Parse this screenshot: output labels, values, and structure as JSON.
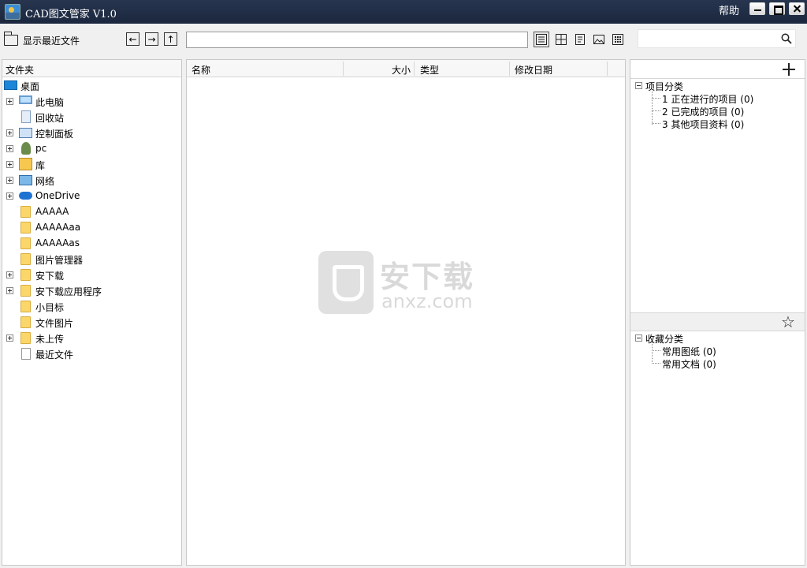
{
  "window": {
    "title": "CAD图文管家 V1.0",
    "help_label": "帮助"
  },
  "toolbar": {
    "recent_files_label": "显示最近文件",
    "path_value": "",
    "search_value": "",
    "view_buttons": [
      "list-view-icon",
      "thumbnail-view-icon",
      "detail-view-icon",
      "image-view-icon",
      "grid-view-icon"
    ]
  },
  "folders": {
    "header": "文件夹",
    "items": [
      {
        "label": "桌面",
        "icon": "desktop-icon",
        "expandable": false
      },
      {
        "label": "此电脑",
        "icon": "computer-icon",
        "expandable": true
      },
      {
        "label": "回收站",
        "icon": "recycle-bin-icon",
        "expandable": false
      },
      {
        "label": "控制面板",
        "icon": "control-panel-icon",
        "expandable": true
      },
      {
        "label": "pc",
        "icon": "user-icon",
        "expandable": true
      },
      {
        "label": "库",
        "icon": "library-icon",
        "expandable": true
      },
      {
        "label": "网络",
        "icon": "network-icon",
        "expandable": true
      },
      {
        "label": "OneDrive",
        "icon": "cloud-icon",
        "expandable": true
      },
      {
        "label": "AAAAA",
        "icon": "folder-icon",
        "expandable": false
      },
      {
        "label": "AAAAAaa",
        "icon": "folder-icon",
        "expandable": false
      },
      {
        "label": "AAAAAas",
        "icon": "folder-icon",
        "expandable": false
      },
      {
        "label": "图片管理器",
        "icon": "folder-icon",
        "expandable": false
      },
      {
        "label": "安下载",
        "icon": "folder-icon",
        "expandable": true
      },
      {
        "label": "安下载应用程序",
        "icon": "folder-icon",
        "expandable": true
      },
      {
        "label": "小目标",
        "icon": "folder-icon",
        "expandable": false
      },
      {
        "label": "文件图片",
        "icon": "folder-icon",
        "expandable": false
      },
      {
        "label": "未上传",
        "icon": "folder-icon",
        "expandable": true
      },
      {
        "label": "最近文件",
        "icon": "document-icon",
        "expandable": false
      }
    ]
  },
  "file_list": {
    "columns": [
      "名称",
      "大小",
      "类型",
      "修改日期"
    ]
  },
  "watermark": {
    "big": "安下载",
    "small": "anxz.com"
  },
  "projects": {
    "root": "项目分类",
    "items": [
      "1 正在进行的项目  (0)",
      "2 已完成的项目  (0)",
      "3 其他项目资料  (0)"
    ]
  },
  "favorites": {
    "root": "收藏分类",
    "items": [
      "常用图纸  (0)",
      "常用文档  (0)"
    ]
  }
}
